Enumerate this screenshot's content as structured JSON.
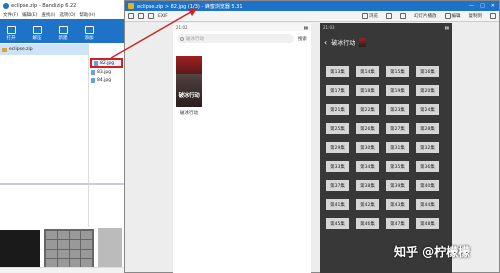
{
  "bandizip": {
    "title": "eclipse.zip - Bandizip 6.22",
    "menu": [
      "文件(F)",
      "编辑(E)",
      "查找(I)",
      "选项(O)",
      "帮助(H)"
    ],
    "toolbar": [
      "打开",
      "解压",
      "新建",
      "添加"
    ],
    "tree_item": "eclipse.zip",
    "files": [
      "82.jpg",
      "83.jpg",
      "84.jpg"
    ]
  },
  "honeyview": {
    "title": "eclipse.zip > 82.jpg (1/3) - 蜂蜜浏览器 5.31",
    "toolbar": {
      "exif": "EXIF",
      "browse": "浏览",
      "slideshow": "幻灯片播放",
      "edit": "编辑",
      "copy": "复制到"
    },
    "left_phone": {
      "time": "21:02",
      "search_placeholder": "破冰行动",
      "search_button": "搜索",
      "poster_title": "破冰行动",
      "card_title": "破冰行动"
    },
    "right_phone": {
      "time": "21:03",
      "header_title": "破冰行动",
      "episodes": [
        "第13集",
        "第14集",
        "第15集",
        "第16集",
        "第17集",
        "第18集",
        "第19集",
        "第20集",
        "第21集",
        "第22集",
        "第23集",
        "第24集",
        "第25集",
        "第26集",
        "第27集",
        "第28集",
        "第29集",
        "第30集",
        "第31集",
        "第32集",
        "第33集",
        "第34集",
        "第35集",
        "第36集",
        "第37集",
        "第38集",
        "第39集",
        "第40集",
        "第41集",
        "第42集",
        "第43集",
        "第44集",
        "第45集",
        "第46集",
        "第47集",
        "第48集"
      ]
    }
  },
  "watermark": "知乎 @柠檬檬",
  "colors": {
    "accent": "#1e73c8",
    "highlight": "#d02020"
  }
}
